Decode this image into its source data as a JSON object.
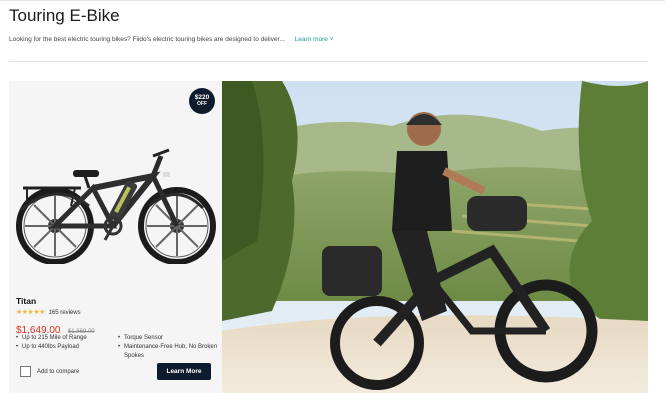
{
  "header": {
    "title": "Touring E-Bike",
    "description": "Looking for the best electric touring bikes? Fiido's electric touring bikes are designed to deliver...",
    "learn_more": "Learn more ˅"
  },
  "product": {
    "badge_amount": "$220",
    "badge_label": "OFF",
    "name": "Titan",
    "stars": "★★★★★",
    "rating": 4.5,
    "reviews": "165 reviews",
    "price": "$1,649.00",
    "old_price": "$1,869.00",
    "features_left": [
      "Up to 215 Mile of Range",
      "Up to 440lbs Payload"
    ],
    "features_right": [
      "Torque Sensor",
      "Maintenance-Free Hub, No Broken Spokes"
    ],
    "compare_label": "Add to compare",
    "cta": "Learn More"
  },
  "colors": {
    "accent": "#1a9e8f",
    "price": "#e0331e",
    "navy": "#0e1b2c",
    "star": "#f4b73b"
  }
}
